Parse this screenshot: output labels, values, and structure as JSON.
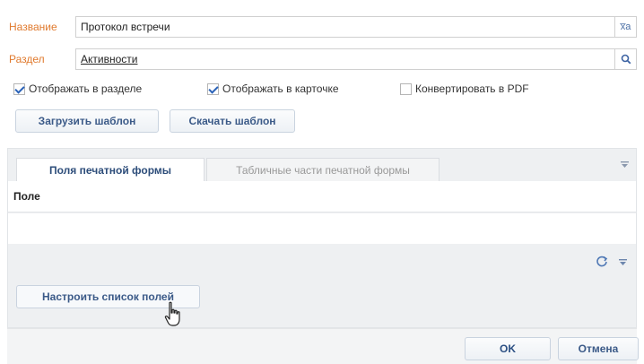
{
  "form": {
    "name_label": "Название",
    "name_value": "Протокол встречи",
    "name_button_icon": "translate-icon",
    "name_button_text": "x̅a",
    "section_label": "Раздел",
    "section_value": "Активности",
    "section_button_icon": "search-icon"
  },
  "checkboxes": [
    {
      "label": "Отображать в разделе",
      "checked": true
    },
    {
      "label": "Отображать в карточке",
      "checked": true
    },
    {
      "label": "Конвертировать в PDF",
      "checked": false
    }
  ],
  "buttons": {
    "upload_template": "Загрузить шаблон",
    "download_template": "Скачать шаблон",
    "configure_fields": "Настроить список полей",
    "ok": "OK",
    "cancel": "Отмена"
  },
  "tabs": [
    {
      "label": "Поля печатной формы",
      "active": true
    },
    {
      "label": "Табличные части печатной формы",
      "active": false
    }
  ],
  "grid": {
    "column_header": "Поле",
    "rows": []
  },
  "colors": {
    "label": "#e07a2e",
    "accent": "#3b5a88",
    "panel_bg": "#eef0f2"
  }
}
